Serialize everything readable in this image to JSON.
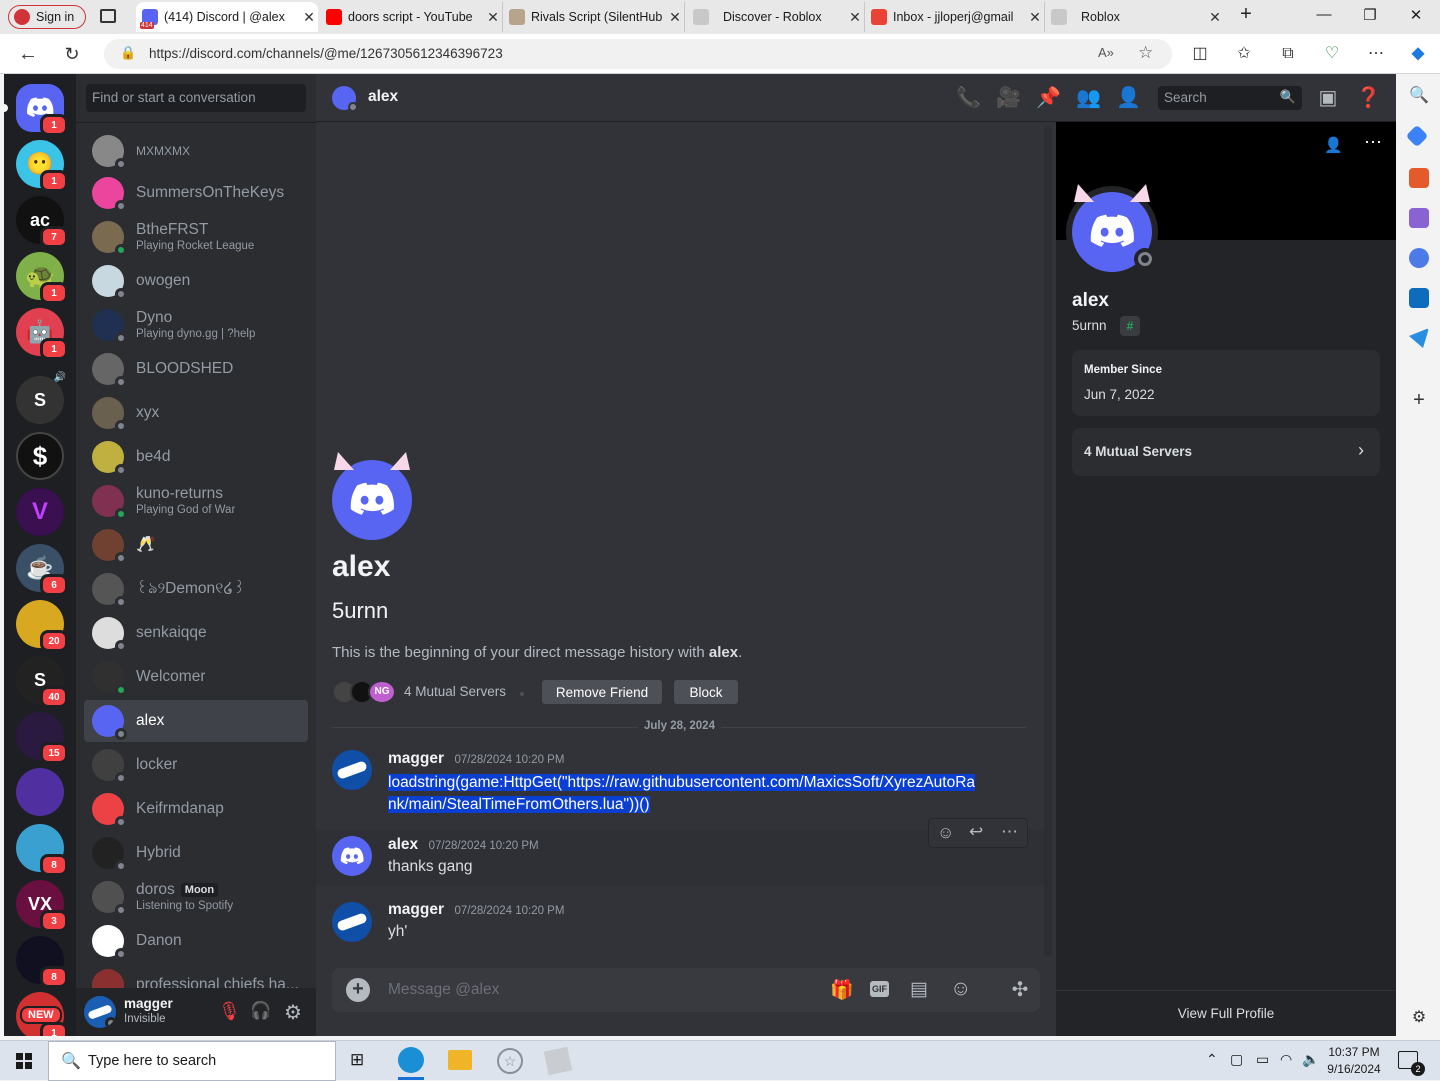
{
  "browser": {
    "signin_label": "Sign in",
    "tabs": [
      {
        "title": "(414) Discord | @alex",
        "color": "#5865f2"
      },
      {
        "title": "doors script - YouTube",
        "color": "#ff0000"
      },
      {
        "title": "Rivals Script (SilentHub",
        "color": "#b8a48a"
      },
      {
        "title": "Discover - Roblox",
        "color": "#c8c8c8"
      },
      {
        "title": "Inbox - jjloperj@gmail",
        "color": "#ea4335"
      },
      {
        "title": "Roblox",
        "color": "#c8c8c8"
      }
    ],
    "url": "https://discord.com/channels/@me/1267305612346396723",
    "discord_tab_badge": "414"
  },
  "guilds": [
    {
      "label": "",
      "badge": "1",
      "color": "#5865f2"
    },
    {
      "label": "",
      "badge": "1",
      "color": "#3bc3e8"
    },
    {
      "label": "ac",
      "badge": "7",
      "color": "#111111"
    },
    {
      "label": "",
      "badge": "1",
      "color": "#7fb04a"
    },
    {
      "label": "",
      "badge": "1",
      "color": "#e04050"
    },
    {
      "label": "S",
      "badge": "",
      "color": "#333333"
    },
    {
      "label": "$",
      "badge": "",
      "color": "#111111"
    },
    {
      "label": "V",
      "badge": "",
      "color": "#3a1050"
    },
    {
      "label": "",
      "badge": "6",
      "color": "#3a5066"
    },
    {
      "label": "",
      "badge": "20",
      "color": "#d8a820"
    },
    {
      "label": "S",
      "badge": "40",
      "color": "#222222"
    },
    {
      "label": "",
      "badge": "15",
      "color": "#2a1a40"
    },
    {
      "label": "",
      "badge": "",
      "color": "#5030a0"
    },
    {
      "label": "",
      "badge": "8",
      "color": "#3aa0d0"
    },
    {
      "label": "VX",
      "badge": "3",
      "color": "#6a1040"
    },
    {
      "label": "",
      "badge": "8",
      "color": "#101020"
    },
    {
      "label": "NEW",
      "badge": "1",
      "color": "#d03030"
    }
  ],
  "dm_search_placeholder": "Find or start a conversation",
  "dms": [
    {
      "name": "MXMXMX",
      "sub": "",
      "online": false,
      "color": "#888888"
    },
    {
      "name": "SummersOnTheKeys",
      "sub": "",
      "online": false,
      "color": "#eb459e"
    },
    {
      "name": "BtheFRST",
      "sub": "Playing Rocket League",
      "online": true,
      "color": "#7a6a50"
    },
    {
      "name": "owogen",
      "sub": "",
      "online": false,
      "color": "#c8d8e0"
    },
    {
      "name": "Dyno",
      "sub": "Playing dyno.gg | ?help",
      "online": false,
      "color": "#203050"
    },
    {
      "name": "BLOODSHED",
      "sub": "",
      "online": false,
      "color": "#666666"
    },
    {
      "name": "xyx",
      "sub": "",
      "online": false,
      "color": "#6a6050"
    },
    {
      "name": "be4d",
      "sub": "",
      "online": false,
      "color": "#c0b040"
    },
    {
      "name": "kuno-returns",
      "sub": "Playing God of War",
      "online": true,
      "color": "#803050"
    },
    {
      "name": "🥂",
      "sub": "",
      "online": false,
      "color": "#704030"
    },
    {
      "name": "꒰ঌ୨Demon୧໒꒱",
      "sub": "",
      "online": false,
      "color": "#555555"
    },
    {
      "name": "senkaiqqe",
      "sub": "",
      "online": false,
      "color": "#dddddd"
    },
    {
      "name": "Welcomer",
      "sub": "",
      "online": true,
      "color": "#303030"
    },
    {
      "name": "alex",
      "sub": "",
      "online": false,
      "color": "#5865f2"
    },
    {
      "name": "locker",
      "sub": "",
      "online": false,
      "color": "#404040"
    },
    {
      "name": "Keifrmdanap",
      "sub": "",
      "online": false,
      "color": "#ed4245"
    },
    {
      "name": "Hybrid",
      "sub": "",
      "online": false,
      "color": "#222222"
    },
    {
      "name": "doros",
      "sub": "Listening to Spotify",
      "online": false,
      "color": "#505050",
      "tag": "Moon"
    },
    {
      "name": "Danon",
      "sub": "",
      "online": false,
      "color": "#ffffff"
    },
    {
      "name": "professional chiefs ha...",
      "sub": "",
      "online": false,
      "color": "#8a3030"
    }
  ],
  "user_panel": {
    "name": "magger",
    "status": "Invisible"
  },
  "header": {
    "name": "alex",
    "search_placeholder": "Search"
  },
  "intro": {
    "name": "alex",
    "username": "5urnn",
    "text_prefix": "This is the beginning of your direct message history with",
    "text_name": "alex",
    "mutual": "4 Mutual Servers",
    "remove_friend": "Remove Friend",
    "block": "Block"
  },
  "divider_date": "July 28, 2024",
  "messages": [
    {
      "author": "magger",
      "time": "07/28/2024 10:20 PM",
      "text": "loadstring(game:HttpGet(\"https://raw.githubusercontent.com/MaxicsSoft/XyrezAutoRank/main/StealTimeFromOthers.lua\"))()",
      "line1": "loadstring(game:HttpGet(\"https://raw.githubusercontent.com/MaxicsSoft/XyrezAutoRa",
      "line2": "nk/main/StealTimeFromOthers.lua\"))()"
    },
    {
      "author": "alex",
      "time": "07/28/2024 10:20 PM",
      "text": "thanks gang"
    },
    {
      "author": "magger",
      "time": "07/28/2024 10:20 PM",
      "text": "yh'"
    }
  ],
  "composer_placeholder": "Message @alex",
  "profile": {
    "name": "alex",
    "username": "5urnn",
    "member_since_label": "Member Since",
    "member_since": "Jun 7, 2022",
    "mutual_servers": "4 Mutual Servers",
    "view_full": "View Full Profile"
  },
  "taskbar": {
    "search_placeholder": "Type here to search",
    "time": "10:37 PM",
    "date": "9/16/2024",
    "notif_count": "2"
  },
  "colors": {
    "blurple": "#5865f2",
    "bg_chat": "#313338",
    "bg_sidebar": "#2b2d31",
    "bg_guilds": "#1e1f22",
    "online": "#23a55a",
    "danger": "#f23f43",
    "selection": "#0b3fd1"
  }
}
